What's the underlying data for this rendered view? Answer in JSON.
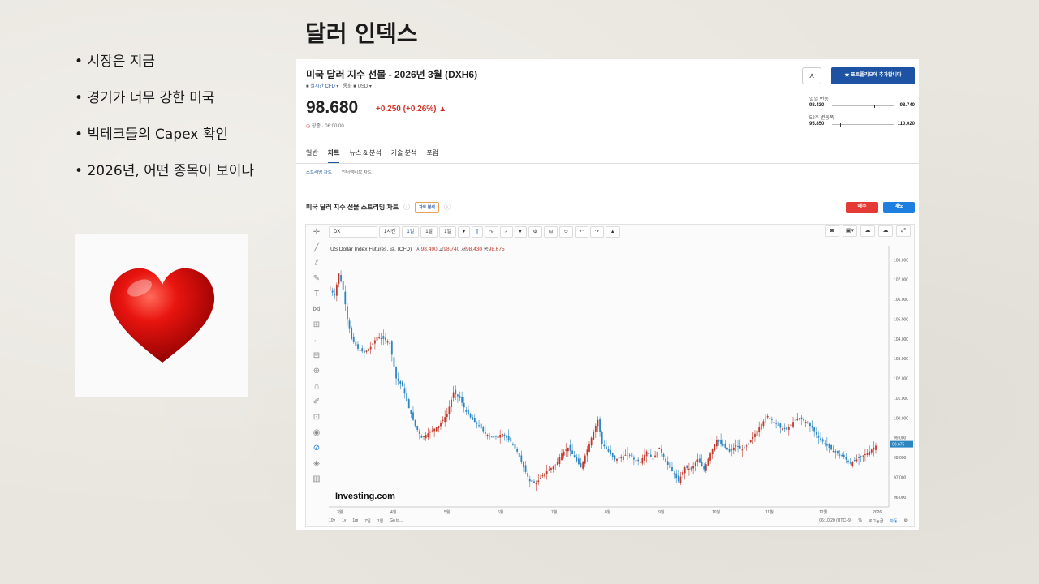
{
  "slide": {
    "title": "달러 인덱스",
    "bullets": [
      "시장은 지금",
      "경기가 너무 강한 미국",
      "빅테크들의 Capex 확인",
      "2026년, 어떤 종목이 보이나"
    ]
  },
  "screenshot": {
    "instrument_title": "미국 달러 지수 선물 - 2026년 3월 (DXH6)",
    "market_label": "실시간 CFD",
    "currency_label": "통화",
    "currency": "USD",
    "price": "98.680",
    "change": "+0.250 (+0.26%) ▲",
    "time_note": "장종 · 06:00:00",
    "alert_icon_label": "⋏",
    "portfolio_button": "★  포트폴리오에 추가합니다",
    "day_range": {
      "label": "일일 변동",
      "low": "98.430",
      "high": "98.740",
      "position": 0.68
    },
    "week52_range": {
      "label": "52주 변동폭",
      "low": "95.850",
      "high": "110.020",
      "position": 0.13
    },
    "tabs": [
      "일반",
      "차트",
      "뉴스 & 분석",
      "기술 분석",
      "포럼"
    ],
    "active_tab": "차트",
    "subtabs": [
      "스트리밍 차트",
      "인터랙티브 차트"
    ],
    "chart_section_title": "미국 달러 지수 선물 스트리밍 차트",
    "chart_badge": "차트 분석",
    "buy_label": "매수",
    "sell_label": "매도",
    "toolbar": {
      "symbol": "DX",
      "intervals": [
        "1시간",
        "1일",
        "1달",
        "1일"
      ],
      "active_interval": "1일"
    },
    "legend": {
      "series": "US Dollar Index Futures, 일, (CFD)",
      "open_label": "시",
      "open": "98.490",
      "high_label": "고",
      "high": "98.740",
      "low_label": "저",
      "low": "98.430",
      "close_label": "종",
      "close": "98.675"
    },
    "watermark": "Investing.com",
    "bottom_ranges": [
      "10y",
      "1y",
      "1m",
      "7일",
      "1일",
      "Go to..."
    ],
    "bottom_time": "06:10:20 (UTC+9)",
    "bottom_scale": [
      "%",
      "로그눈금",
      "자동"
    ]
  },
  "chart_data": {
    "type": "candlestick",
    "x_ticks": [
      "3월",
      "4월",
      "5월",
      "6월",
      "7월",
      "8월",
      "9월",
      "10월",
      "11월",
      "12월",
      "2026"
    ],
    "y_ticks": [
      96.0,
      97.0,
      98.0,
      99.0,
      100.0,
      101.0,
      102.0,
      103.0,
      104.0,
      105.0,
      106.0,
      107.0,
      108.0
    ],
    "ylim": [
      95.5,
      108.3
    ],
    "last_price": 98.675,
    "last_price_label": "98.675",
    "close_path": [
      [
        0,
        106.5
      ],
      [
        2,
        106.2
      ],
      [
        4,
        107.3
      ],
      [
        6,
        106.5
      ],
      [
        8,
        105.0
      ],
      [
        10,
        104.0
      ],
      [
        13,
        103.5
      ],
      [
        16,
        103.3
      ],
      [
        19,
        103.6
      ],
      [
        22,
        104.1
      ],
      [
        25,
        104.0
      ],
      [
        28,
        103.8
      ],
      [
        31,
        102.0
      ],
      [
        34,
        101.6
      ],
      [
        37,
        100.5
      ],
      [
        40,
        99.6
      ],
      [
        43,
        99.0
      ],
      [
        47,
        99.3
      ],
      [
        51,
        99.6
      ],
      [
        55,
        100.2
      ],
      [
        58,
        101.3
      ],
      [
        61,
        101.0
      ],
      [
        64,
        100.3
      ],
      [
        67,
        99.9
      ],
      [
        70,
        99.6
      ],
      [
        73,
        99.2
      ],
      [
        77,
        99.0
      ],
      [
        81,
        99.2
      ],
      [
        85,
        98.8
      ],
      [
        88,
        98.3
      ],
      [
        91,
        97.5
      ],
      [
        94,
        96.8
      ],
      [
        97,
        96.7
      ],
      [
        100,
        97.1
      ],
      [
        103,
        97.4
      ],
      [
        106,
        97.6
      ],
      [
        109,
        98.2
      ],
      [
        112,
        98.5
      ],
      [
        115,
        98.0
      ],
      [
        118,
        97.5
      ],
      [
        121,
        98.4
      ],
      [
        124,
        99.3
      ],
      [
        126,
        99.9
      ],
      [
        128,
        98.7
      ],
      [
        131,
        98.3
      ],
      [
        134,
        97.9
      ],
      [
        137,
        98.0
      ],
      [
        140,
        98.2
      ],
      [
        143,
        97.9
      ],
      [
        146,
        97.8
      ],
      [
        149,
        98.3
      ],
      [
        152,
        97.9
      ],
      [
        155,
        98.5
      ],
      [
        158,
        97.8
      ],
      [
        161,
        97.3
      ],
      [
        164,
        96.8
      ],
      [
        167,
        97.5
      ],
      [
        170,
        97.4
      ],
      [
        173,
        97.9
      ],
      [
        176,
        97.4
      ],
      [
        179,
        98.2
      ],
      [
        182,
        98.9
      ],
      [
        185,
        98.6
      ],
      [
        188,
        98.3
      ],
      [
        191,
        98.6
      ],
      [
        194,
        98.4
      ],
      [
        197,
        98.7
      ],
      [
        200,
        99.2
      ],
      [
        203,
        99.7
      ],
      [
        206,
        100.1
      ],
      [
        209,
        99.8
      ],
      [
        212,
        99.5
      ],
      [
        215,
        99.4
      ],
      [
        218,
        99.8
      ],
      [
        221,
        100.0
      ],
      [
        224,
        99.8
      ],
      [
        227,
        99.5
      ],
      [
        230,
        99.0
      ],
      [
        233,
        98.7
      ],
      [
        236,
        98.4
      ],
      [
        239,
        98.2
      ],
      [
        242,
        98.0
      ],
      [
        245,
        97.7
      ],
      [
        248,
        97.9
      ],
      [
        251,
        98.1
      ],
      [
        254,
        98.3
      ],
      [
        257,
        98.6
      ]
    ]
  },
  "colors": {
    "up": "#c0392b",
    "down": "#2e86c1",
    "accent": "#1e53a3",
    "buy": "#e53935",
    "sell": "#1e7fe0"
  }
}
